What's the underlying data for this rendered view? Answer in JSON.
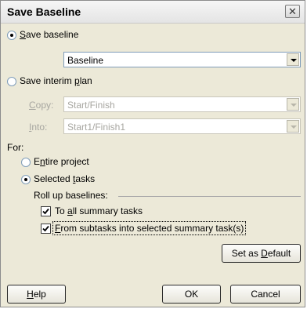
{
  "dialog": {
    "title": "Save Baseline",
    "close_icon": "close-icon"
  },
  "save_baseline": {
    "label_pre": "",
    "label_mnemonic": "S",
    "label_post": "ave baseline",
    "selected": true,
    "combo_value": "Baseline"
  },
  "save_interim": {
    "label_pre": "Save interim ",
    "label_mnemonic": "p",
    "label_post": "lan",
    "selected": false,
    "copy_label_mnemonic": "C",
    "copy_label_post": "opy:",
    "copy_value": "Start/Finish",
    "into_label_mnemonic": "I",
    "into_label_post": "nto:",
    "into_value": "Start1/Finish1"
  },
  "for_section": {
    "label": "For:",
    "entire_pre": "E",
    "entire_mnemonic": "n",
    "entire_post": "tire project",
    "entire_selected": false,
    "selected_pre": "Selected ",
    "selected_mnemonic": "t",
    "selected_post": "asks",
    "selected_selected": true
  },
  "rollup": {
    "label": "Roll up baselines:",
    "to_all_pre": "To ",
    "to_all_mnemonic": "a",
    "to_all_post": "ll summary tasks",
    "to_all_checked": true,
    "from_sub_pre": "",
    "from_sub_mnemonic": "F",
    "from_sub_post": "rom subtasks into selected summary task(s)",
    "from_sub_checked": true
  },
  "buttons": {
    "set_default_pre": "Set as ",
    "set_default_mnemonic": "D",
    "set_default_post": "efault",
    "help_pre": "",
    "help_mnemonic": "H",
    "help_post": "elp",
    "ok": "OK",
    "cancel": "Cancel"
  },
  "colors": {
    "dialog_bg": "#ece9d8",
    "disabled_text": "#a7a6a0"
  }
}
